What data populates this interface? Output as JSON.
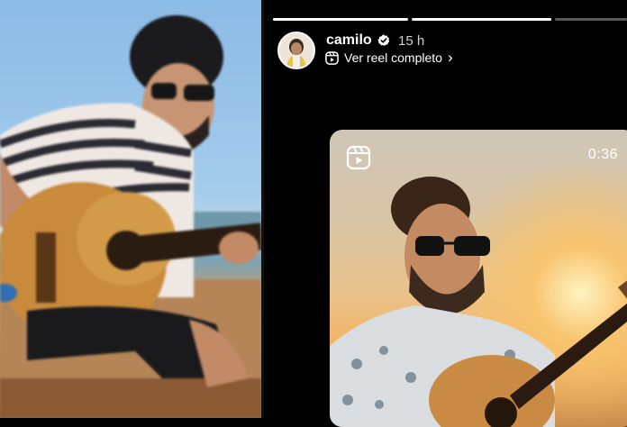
{
  "story": {
    "progress_segments": [
      {
        "fill": 1.0
      },
      {
        "fill": 1.0
      },
      {
        "fill": 0.0
      }
    ],
    "username": "camilo",
    "verified": true,
    "time_ago": "15 h",
    "reel_link_label": "Ver reel completo",
    "reel_link_chevron": "›",
    "reel": {
      "duration": "0:36",
      "icon": "reels-icon"
    },
    "avatar_icon": "profile-avatar"
  },
  "colors": {
    "background": "#000000",
    "text": "#ffffff",
    "verified_badge": "#ffffff"
  }
}
